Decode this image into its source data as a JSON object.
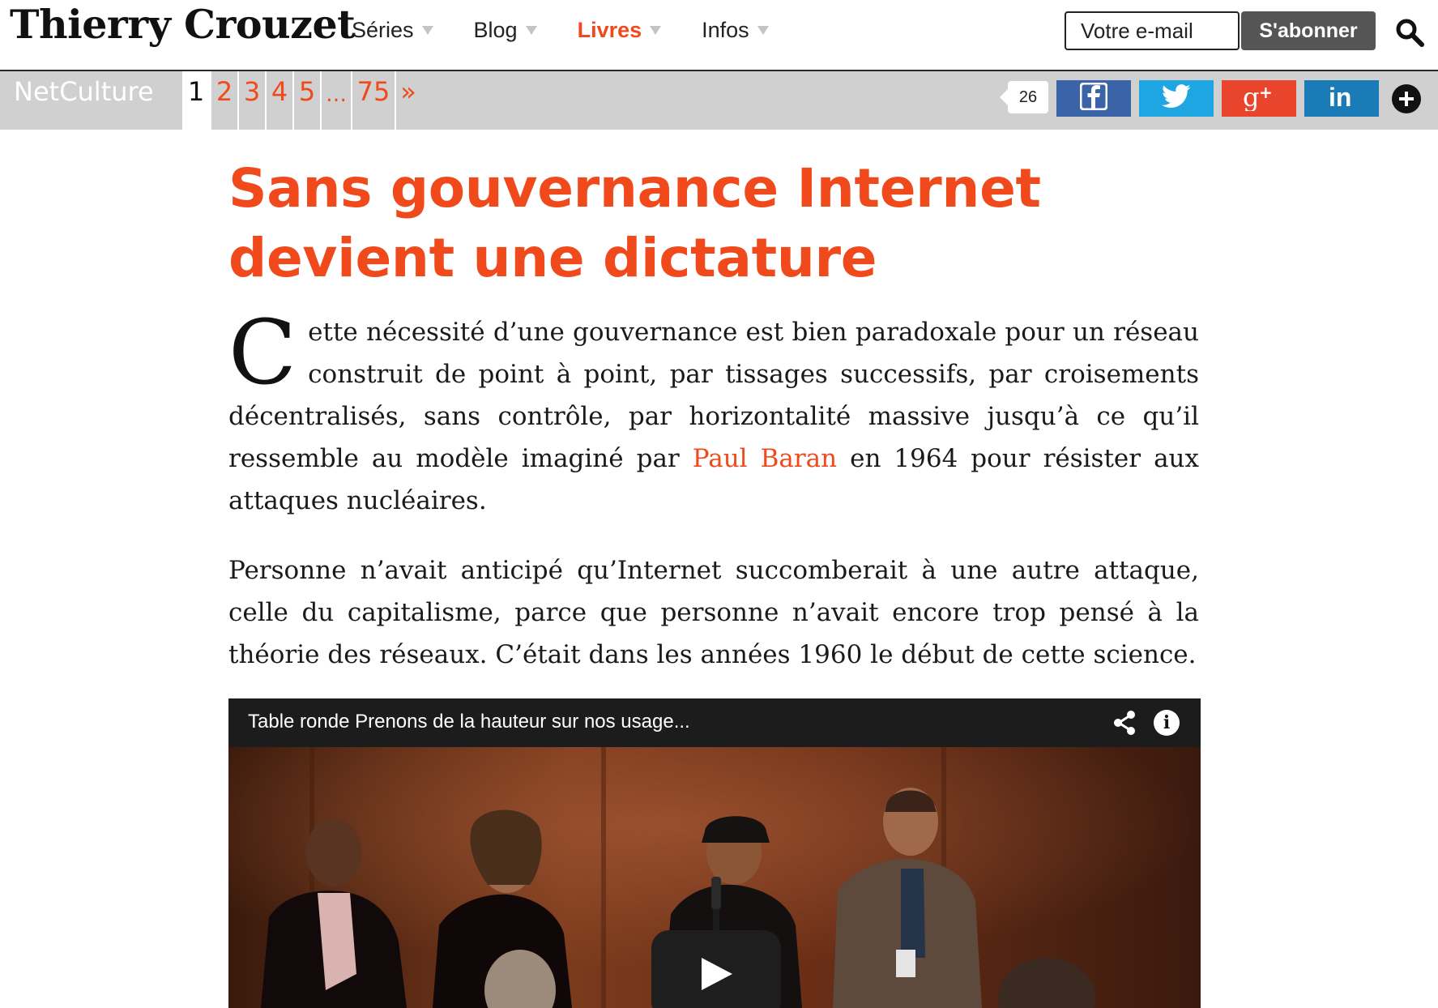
{
  "site": {
    "title": "Thierry Crouzet"
  },
  "nav": {
    "items": [
      {
        "label": "Séries"
      },
      {
        "label": "Blog"
      },
      {
        "label": "Livres"
      },
      {
        "label": "Infos"
      }
    ],
    "active_item": "Livres"
  },
  "subscribe": {
    "placeholder": "Votre e-mail",
    "button_label": "S'abonner"
  },
  "icons": {
    "search": "search-icon",
    "more": "plus-circle-icon",
    "facebook": "facebook-icon",
    "twitter": "twitter-icon",
    "google_plus": "google-plus-icon",
    "linkedin": "linkedin-icon",
    "video_share": "share-icon",
    "video_info": "info-icon",
    "play": "play-icon"
  },
  "series": {
    "name": "NetCulture",
    "pages": [
      "1",
      "2",
      "3",
      "4",
      "5",
      "…",
      "75",
      "»"
    ],
    "current_page": "1"
  },
  "share": {
    "count": "26",
    "buttons": {
      "facebook": "f",
      "google_plus": "g+",
      "linkedin": "in"
    }
  },
  "colors": {
    "accent": "#f04a1c",
    "series_bar": "#d0d0d0",
    "facebook": "#3b64a8",
    "twitter": "#1ea6e3",
    "google_plus": "#e9452c",
    "linkedin": "#1b7bb7"
  },
  "article": {
    "title": "Sans gouvernance Internet devient une dictature",
    "para1": {
      "dropcap": "C",
      "before_link": "ette nécessité d’une gouvernance est bien paradoxale pour un réseau construit de point à point, par tissages successifs, par croisements décentralisés, sans contrôle, par horizontalité massive jusqu’à ce qu’il ressemble au modèle imaginé par ",
      "link": "Paul Baran",
      "after_link": " en 1964 pour résister aux attaques nucléaires."
    },
    "para2": "Personne n’avait anticipé qu’Internet succomberait à une autre attaque, celle du capitalisme, parce que personne n’avait encore trop pensé à la théorie des réseaux. C’était dans les années 1960 le début de cette science."
  },
  "video": {
    "title": "Table ronde Prenons de la hauteur sur nos usage..."
  }
}
